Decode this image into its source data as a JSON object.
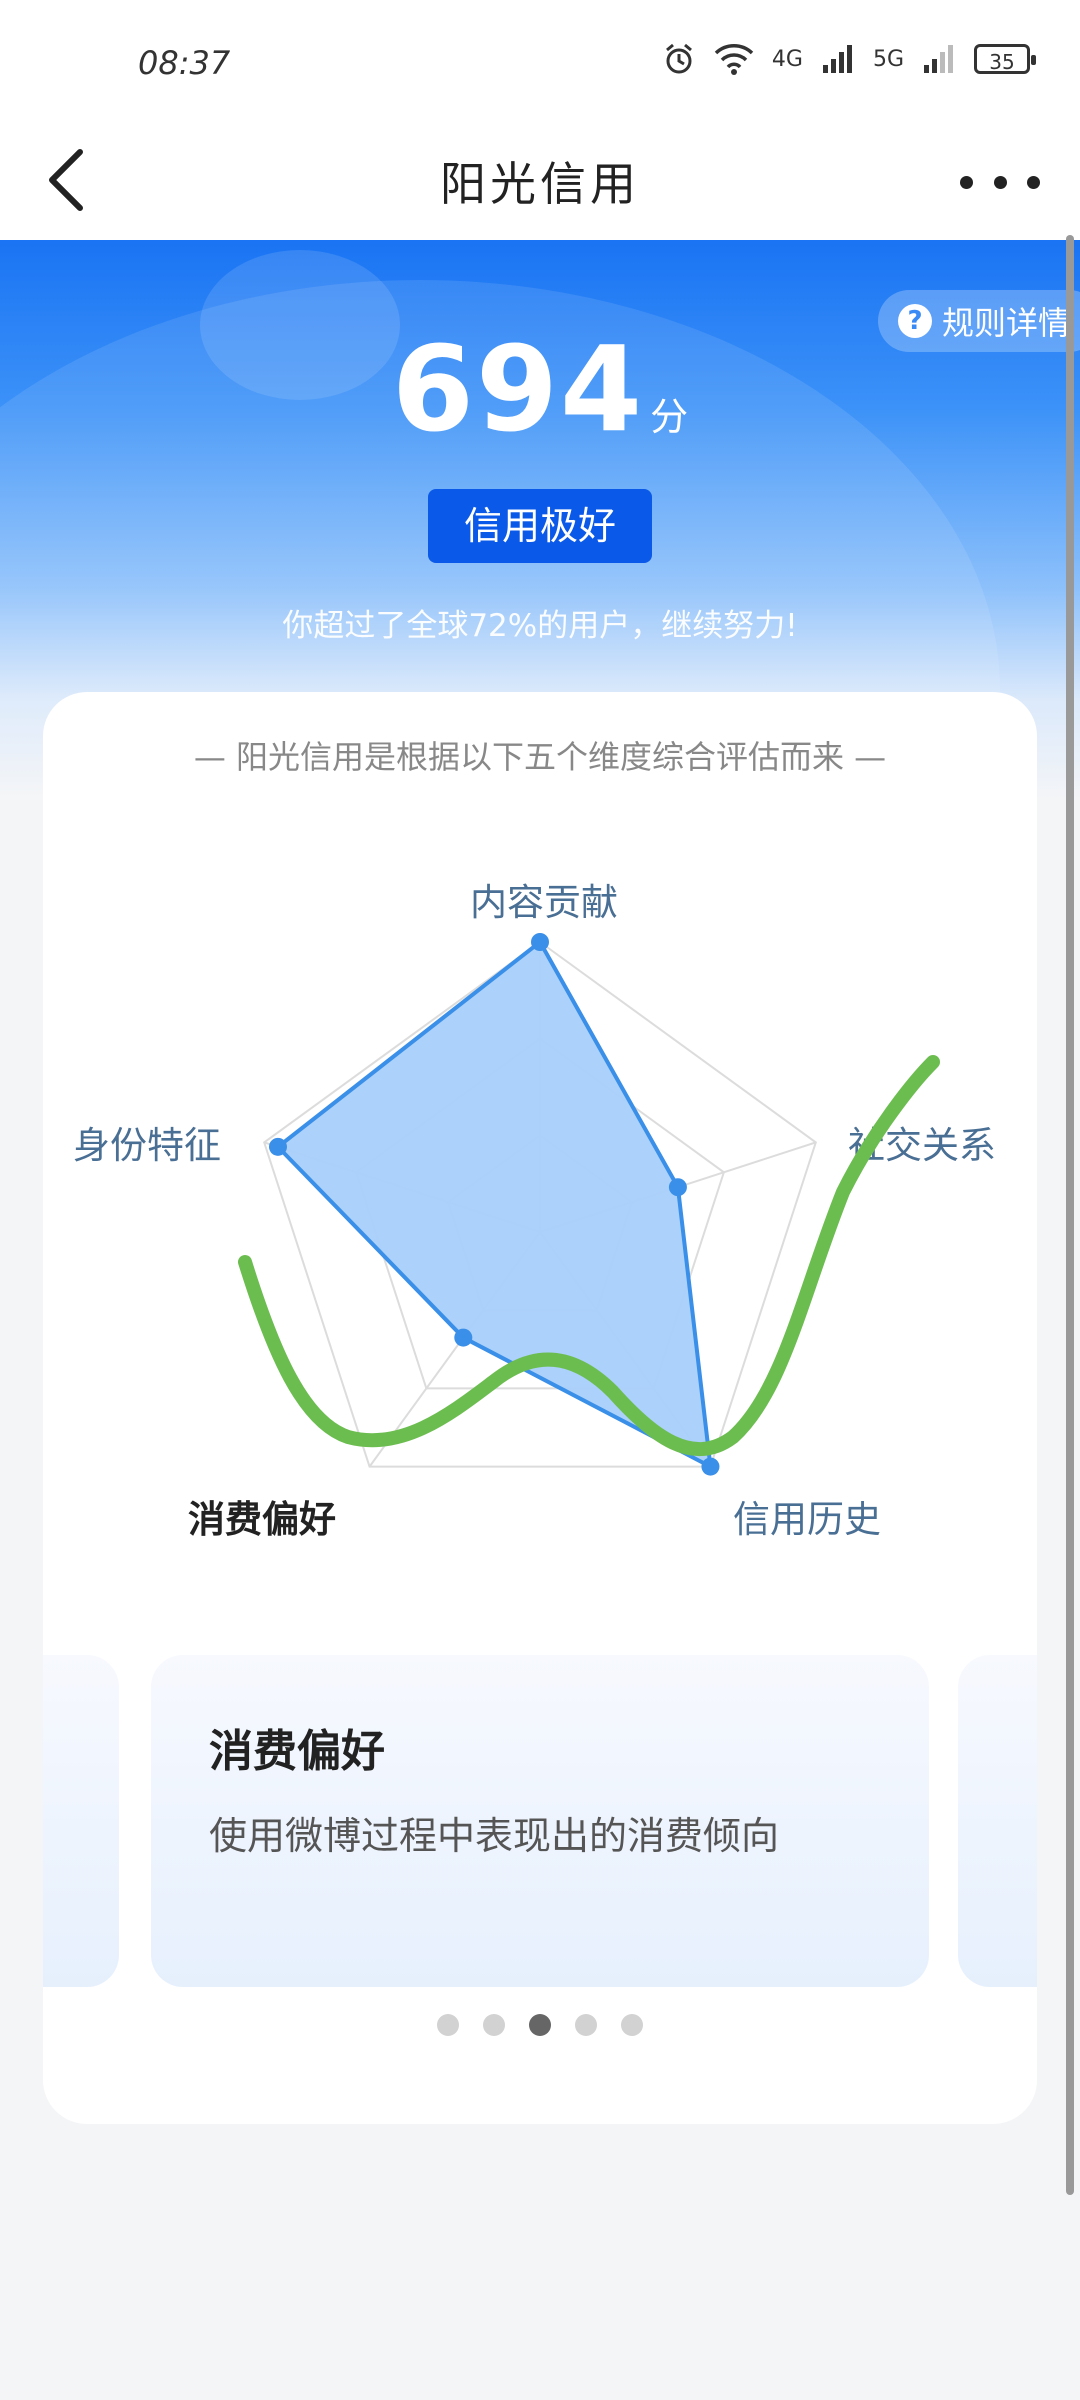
{
  "status_bar": {
    "time": "08:37",
    "network_a": "4G",
    "network_b": "5G",
    "battery": "35"
  },
  "nav": {
    "title": "阳光信用"
  },
  "hero": {
    "rules_label": "规则详情",
    "score": "694",
    "score_unit": "分",
    "level_badge": "信用极好",
    "beat_text": "你超过了全球72%的用户，继续努力!"
  },
  "card": {
    "caption": "— 阳光信用是根据以下五个维度综合评估而来 —",
    "dimensions": [
      "内容贡献",
      "社交关系",
      "信用历史",
      "消费偏好",
      "身份特征"
    ],
    "active_dimension": "消费偏好",
    "radar_values": [
      1.0,
      0.5,
      1.0,
      0.45,
      0.95
    ],
    "slides": [
      {
        "title": "消费偏好",
        "desc": "使用微博过程中表现出的消费倾向"
      }
    ],
    "pager": {
      "count": 5,
      "active_index": 2
    }
  },
  "colors": {
    "brand": "#1a74f3",
    "radar_fill": "#a8cffa",
    "radar_stroke": "#3a8fe8",
    "annotation": "#6cbd50"
  }
}
